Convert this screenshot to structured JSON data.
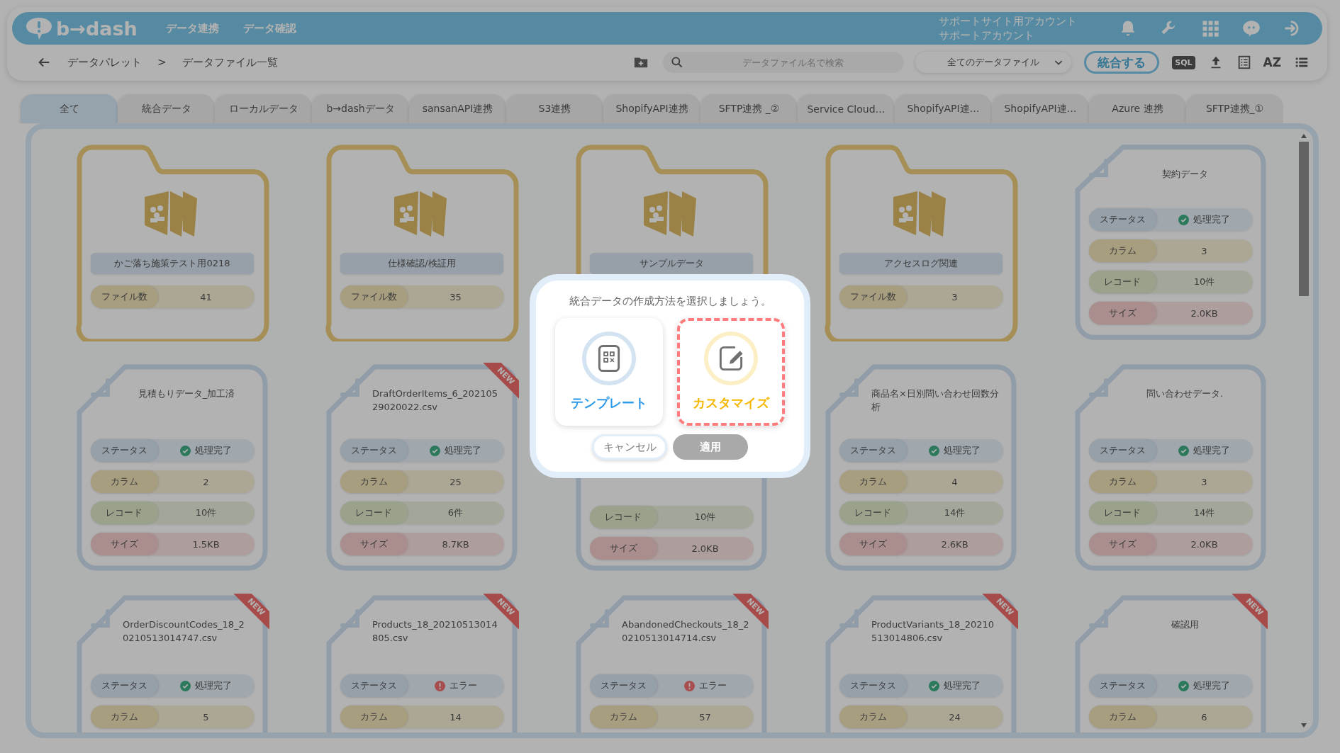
{
  "header": {
    "logo": "b→dash",
    "nav": [
      "データ連携",
      "データ確認"
    ],
    "account": [
      "サポートサイト用アカウント",
      "サポートアカウント"
    ]
  },
  "toolbar": {
    "breadcrumb": [
      "データパレット",
      "データファイル一覧"
    ],
    "separator": ">",
    "search": {
      "placeholder": "データファイル名で検索"
    },
    "filter": "全てのデータファイル",
    "merge_button": "統合する",
    "sql_label": "SQL",
    "sort_label": "AZ"
  },
  "tabs": [
    {
      "label": "全て",
      "selected": true
    },
    {
      "label": "統合データ",
      "selected": false
    },
    {
      "label": "ローカルデータ",
      "selected": false
    },
    {
      "label": "b→dashデータ",
      "selected": false
    },
    {
      "label": "sansanAPI連携",
      "selected": false
    },
    {
      "label": "S3連携",
      "selected": false
    },
    {
      "label": "ShopifyAPI連携",
      "selected": false
    },
    {
      "label": "SFTP連携 _②",
      "selected": false
    },
    {
      "label": "Service Cloud…",
      "selected": false
    },
    {
      "label": "ShopifyAPI連…",
      "selected": false
    },
    {
      "label": "ShopifyAPI連…",
      "selected": false
    },
    {
      "label": "Azure 連携",
      "selected": false
    },
    {
      "label": "SFTP連携_①",
      "selected": false
    }
  ],
  "cards": [
    {
      "kind": "folder",
      "title": "かご落ち施策テスト用0218",
      "rows": [
        {
          "kind": "count",
          "label": "ファイル数",
          "value": "41"
        }
      ]
    },
    {
      "kind": "folder",
      "title": "仕様確認/検証用",
      "rows": [
        {
          "kind": "count",
          "label": "ファイル数",
          "value": "35"
        }
      ]
    },
    {
      "kind": "folder",
      "title": "サンプルデータ"
    },
    {
      "kind": "folder",
      "title": "アクセスログ関連",
      "rows": [
        {
          "kind": "count",
          "label": "ファイル数",
          "value": "3"
        }
      ]
    },
    {
      "kind": "file",
      "title": "契約データ",
      "rows": [
        {
          "kind": "status",
          "label": "ステータス",
          "value": "処理完了",
          "error": false
        },
        {
          "kind": "columns",
          "label": "カラム",
          "value": "3"
        },
        {
          "kind": "records",
          "label": "レコード",
          "value": "10件"
        },
        {
          "kind": "size",
          "label": "サイズ",
          "value": "2.0KB"
        }
      ]
    },
    {
      "kind": "file",
      "title": "見積もりデータ_加工済",
      "rows": [
        {
          "kind": "status",
          "label": "ステータス",
          "value": "処理完了",
          "error": false
        },
        {
          "kind": "columns",
          "label": "カラム",
          "value": "2"
        },
        {
          "kind": "records",
          "label": "レコード",
          "value": "10件"
        },
        {
          "kind": "size",
          "label": "サイズ",
          "value": "1.5KB"
        }
      ]
    },
    {
      "kind": "file",
      "title": "DraftOrderItems_6_20210529020022.csv",
      "ribbon": "NEW",
      "rows": [
        {
          "kind": "status",
          "label": "ステータス",
          "value": "処理完了",
          "error": false
        },
        {
          "kind": "columns",
          "label": "カラム",
          "value": "25"
        },
        {
          "kind": "records",
          "label": "レコード",
          "value": "6件"
        },
        {
          "kind": "size",
          "label": "サイズ",
          "value": "8.7KB"
        }
      ]
    },
    {
      "kind": "file",
      "rows": [
        {
          "kind": "records",
          "label": "レコード",
          "value": "10件"
        },
        {
          "kind": "size",
          "label": "サイズ",
          "value": "2.0KB"
        }
      ]
    },
    {
      "kind": "file",
      "title": "商品名×日別問い合わせ回数分析",
      "rows": [
        {
          "kind": "status",
          "label": "ステータス",
          "value": "処理完了",
          "error": false
        },
        {
          "kind": "columns",
          "label": "カラム",
          "value": "4"
        },
        {
          "kind": "records",
          "label": "レコード",
          "value": "14件"
        },
        {
          "kind": "size",
          "label": "サイズ",
          "value": "2.6KB"
        }
      ]
    },
    {
      "kind": "file",
      "title": "問い合わせデータ.",
      "rows": [
        {
          "kind": "status",
          "label": "ステータス",
          "value": "処理完了",
          "error": false
        },
        {
          "kind": "columns",
          "label": "カラム",
          "value": "3"
        },
        {
          "kind": "records",
          "label": "レコード",
          "value": "14件"
        },
        {
          "kind": "size",
          "label": "サイズ",
          "value": "2.0KB"
        }
      ]
    },
    {
      "kind": "file",
      "title": "OrderDiscountCodes_18_20210513014747.csv",
      "ribbon": "NEW",
      "rows": [
        {
          "kind": "status",
          "label": "ステータス",
          "value": "処理完了",
          "error": false
        },
        {
          "kind": "columns",
          "label": "カラム",
          "value": "5"
        }
      ]
    },
    {
      "kind": "file",
      "title": "Products_18_20210513014805.csv",
      "ribbon": "NEW",
      "rows": [
        {
          "kind": "status",
          "label": "ステータス",
          "value": "エラー",
          "error": true
        },
        {
          "kind": "columns",
          "label": "カラム",
          "value": "14"
        }
      ]
    },
    {
      "kind": "file",
      "title": "AbandonedCheckouts_18_20210513014714.csv",
      "ribbon": "NEW",
      "rows": [
        {
          "kind": "status",
          "label": "ステータス",
          "value": "エラー",
          "error": true
        },
        {
          "kind": "columns",
          "label": "カラム",
          "value": "57"
        }
      ]
    },
    {
      "kind": "file",
      "title": "ProductVariants_18_20210513014806.csv",
      "ribbon": "NEW",
      "rows": [
        {
          "kind": "status",
          "label": "ステータス",
          "value": "処理完了",
          "error": false
        },
        {
          "kind": "columns",
          "label": "カラム",
          "value": "24"
        }
      ]
    },
    {
      "kind": "file",
      "title": "確認用",
      "ribbon": "NEW",
      "rows": [
        {
          "kind": "status",
          "label": "ステータス",
          "value": "処理完了",
          "error": false
        },
        {
          "kind": "columns",
          "label": "カラム",
          "value": "6"
        }
      ]
    }
  ],
  "modal": {
    "prompt": "統合データの作成方法を選択しましょう。",
    "options": [
      {
        "label": "テンプレート",
        "kind": "template",
        "selected": false
      },
      {
        "label": "カスタマイズ",
        "kind": "custom",
        "selected": true
      }
    ],
    "buttons": [
      {
        "label": "キャンセル",
        "disabled": false
      },
      {
        "label": "適用",
        "disabled": true
      }
    ]
  }
}
